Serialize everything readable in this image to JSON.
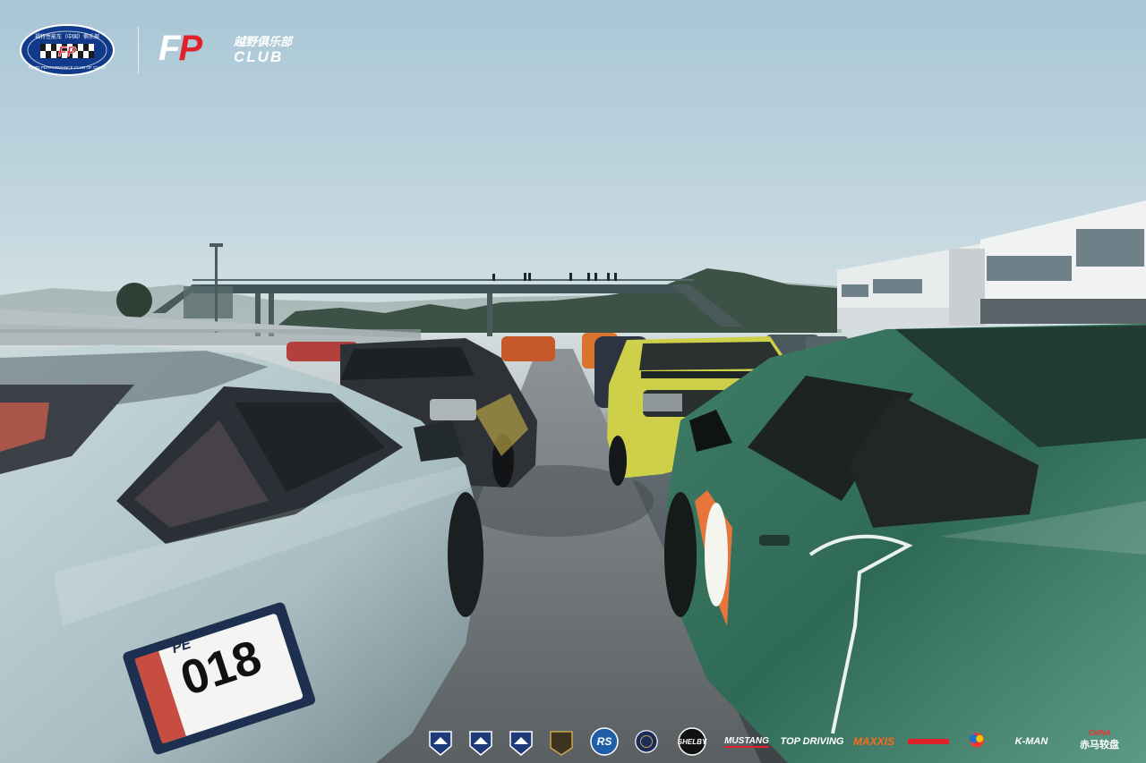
{
  "branding": {
    "club_cn": "福特性能车（中国）俱乐部",
    "club_en": "FORD PERFORMANCE CLUB OF CHINA",
    "badge_mark": "FP",
    "fp_letter_f": "F",
    "fp_letter_p": "P",
    "fp_club_cn": "越野俱乐部",
    "fp_club_en": "CLUB"
  },
  "sponsors": [
    {
      "label": "RS",
      "color": "#ffffff"
    },
    {
      "label": "SHELBY",
      "color": "#ffffff"
    },
    {
      "label": "MUSTANG",
      "color": "#ffffff"
    },
    {
      "label": "TOP DRIVING",
      "color": "#ffffff"
    },
    {
      "label": "MAXXIS",
      "color": "#ff6a1a"
    },
    {
      "label": "K-MAN",
      "color": "#ffffff"
    },
    {
      "label": "CHINA",
      "color": "#e8333a"
    },
    {
      "label": "赤马较盘",
      "color": "#ffffff"
    }
  ],
  "race_number": {
    "value": "018",
    "series": "PE"
  },
  "colors": {
    "brand_red": "#e0212b",
    "ford_blue": "#123a8a",
    "mustang_green": "#2f6a56",
    "mustang_yellow": "#cfd04a",
    "mustang_silver": "#b9cdd0"
  }
}
